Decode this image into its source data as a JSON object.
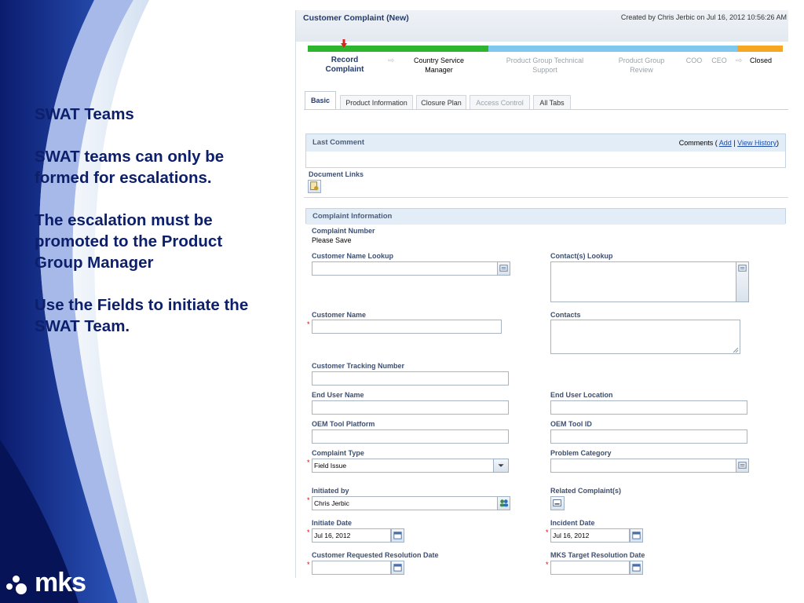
{
  "slide": {
    "paragraphs": [
      "SWAT Teams",
      "SWAT teams can only be formed for escalations.",
      "The escalation must be promoted to the Product Group Manager",
      "Use the Fields to initiate the SWAT Team."
    ],
    "logo_text": "mks"
  },
  "screen": {
    "title": "Customer Complaint (New)",
    "created": "Created by Chris Jerbic on Jul 16, 2012 10:56:26 AM",
    "workflow": {
      "stages": [
        {
          "label": "Record Complaint",
          "state": "current"
        },
        {
          "label": "Country Service Manager",
          "state": "next"
        },
        {
          "label": "Product Group Technical Support",
          "state": "future"
        },
        {
          "label": "Product Group Review",
          "state": "future"
        },
        {
          "label": "COO",
          "state": "future"
        },
        {
          "label": "CEO",
          "state": "future"
        },
        {
          "label": "Closed",
          "state": "final"
        }
      ],
      "colors": {
        "done": "#2db52d",
        "future": "#7ec8f0",
        "final": "#f5a623"
      }
    },
    "tabs": [
      {
        "label": "Basic",
        "state": "active"
      },
      {
        "label": "Product Information",
        "state": "normal"
      },
      {
        "label": "Closure Plan",
        "state": "normal"
      },
      {
        "label": "Access Control",
        "state": "disabled"
      },
      {
        "label": "All Tabs",
        "state": "normal"
      }
    ],
    "last_comment": {
      "heading": "Last Comment",
      "comments_prefix": "Comments (",
      "add_link": "Add",
      "separator": "|",
      "history_link": "View History",
      "comments_suffix": ")"
    },
    "document_links": {
      "heading": "Document Links",
      "icon": "attach-document-icon"
    },
    "complaint_info": {
      "heading": "Complaint Information",
      "complaint_number_label": "Complaint Number",
      "complaint_number_value": "Please Save",
      "fields": {
        "customer_name_lookup": {
          "label": "Customer Name Lookup",
          "value": ""
        },
        "contacts_lookup": {
          "label": "Contact(s) Lookup",
          "value": ""
        },
        "customer_name": {
          "label": "Customer Name",
          "value": "",
          "required": true
        },
        "contacts": {
          "label": "Contacts",
          "value": ""
        },
        "customer_tracking_number": {
          "label": "Customer Tracking Number",
          "value": ""
        },
        "end_user_name": {
          "label": "End User Name",
          "value": ""
        },
        "end_user_location": {
          "label": "End User Location",
          "value": ""
        },
        "oem_tool_platform": {
          "label": "OEM Tool Platform",
          "value": ""
        },
        "oem_tool_id": {
          "label": "OEM Tool ID",
          "value": ""
        },
        "complaint_type": {
          "label": "Complaint Type",
          "value": "Field Issue",
          "required": true
        },
        "problem_category": {
          "label": "Problem Category",
          "value": ""
        },
        "initiated_by": {
          "label": "Initiated by",
          "value": "Chris Jerbic",
          "required": true
        },
        "related_complaints": {
          "label": "Related Complaint(s)",
          "value": ""
        },
        "initiate_date": {
          "label": "Initiate Date",
          "value": "Jul 16, 2012",
          "required": true
        },
        "incident_date": {
          "label": "Incident Date",
          "value": "Jul 16, 2012",
          "required": true
        },
        "customer_requested_resolution_date": {
          "label": "Customer Requested Resolution Date",
          "value": "",
          "required": true
        },
        "mks_target_resolution_date": {
          "label": "MKS Target Resolution Date",
          "value": "",
          "required": true
        }
      }
    }
  },
  "required_marker": "*"
}
